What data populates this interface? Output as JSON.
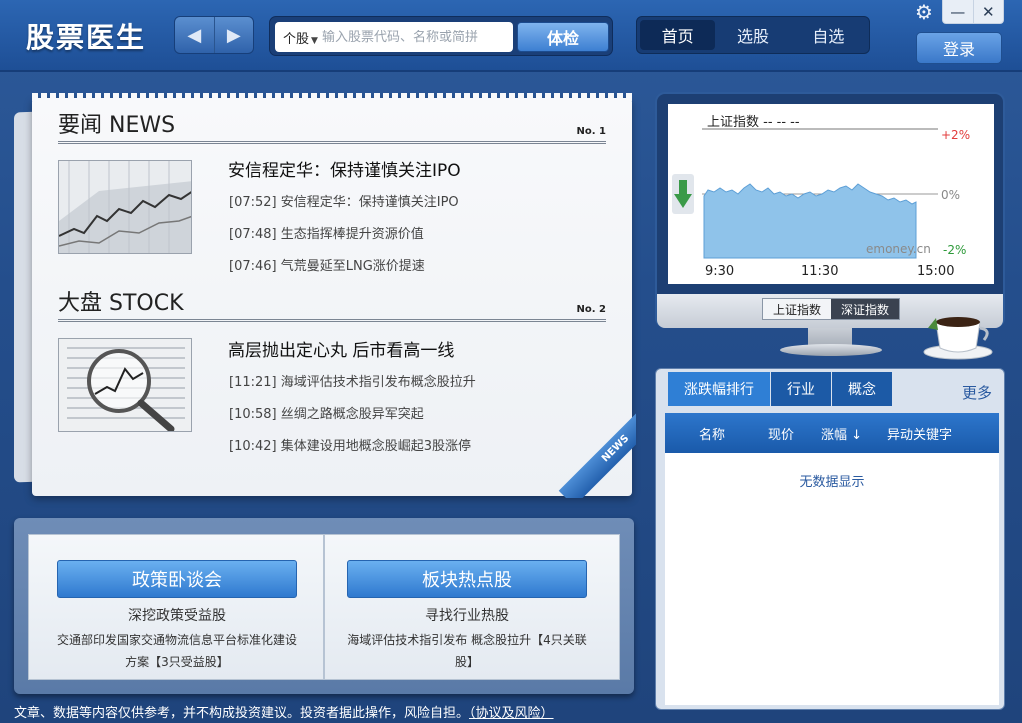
{
  "app": {
    "title": "股票医生"
  },
  "header": {
    "search_type": "个股",
    "search_placeholder": "输入股票代码、名称或简拼",
    "check_button": "体检",
    "tabs": [
      {
        "label": "首页",
        "active": true
      },
      {
        "label": "选股",
        "active": false
      },
      {
        "label": "自选",
        "active": false
      }
    ],
    "login_button": "登录",
    "window": {
      "minimize": "—",
      "close": "✕"
    }
  },
  "news": {
    "section1": {
      "title": "要闻 NEWS",
      "no": "No. 1",
      "headline": "安信程定华：保持谨慎关注IPO",
      "items": [
        "[07:52] 安信程定华：保持谨慎关注IPO",
        "[07:48] 生态指挥棒提升资源价值",
        "[07:46] 气荒曼延至LNG涨价提速"
      ]
    },
    "section2": {
      "title": "大盘 STOCK",
      "no": "No. 2",
      "headline": "高层抛出定心丸 后市看高一线",
      "items": [
        "[11:21] 海域评估技术指引发布概念股拉升",
        "[10:58] 丝绸之路概念股异军突起",
        "[10:42] 集体建设用地概念股崛起3股涨停"
      ]
    },
    "ribbon": "NEWS"
  },
  "book": {
    "left": {
      "button": "政策卧谈会",
      "subtitle": "深挖政策受益股",
      "desc": "交通部印发国家交通物流信息平台标准化建设方案【3只受益股】"
    },
    "right": {
      "button": "板块热点股",
      "subtitle": "寻找行业热股",
      "desc": "海域评估技术指引发布 概念股拉升【4只关联股】"
    }
  },
  "index_chart": {
    "title": "上证指数 -- -- --",
    "pct_labels": {
      "up": "+2%",
      "zero": "0%",
      "down": "-2%"
    },
    "watermark": "emoney.cn",
    "time_labels": [
      "9:30",
      "11:30",
      "15:00"
    ],
    "tabs": [
      {
        "label": "上证指数",
        "active": false
      },
      {
        "label": "深证指数",
        "active": true
      }
    ],
    "colors": {
      "up": "#e23b3b",
      "down": "#2e9a3a",
      "area": "#8fc3ea"
    }
  },
  "ranking": {
    "tabs": [
      {
        "label": "涨跌幅排行",
        "active": true
      },
      {
        "label": "行业",
        "active": false
      },
      {
        "label": "概念",
        "active": false
      }
    ],
    "more": "更多",
    "columns": {
      "name": "名称",
      "price": "现价",
      "change": "涨幅",
      "sort_arrow": "↓",
      "keyword": "异动关键字"
    },
    "empty_text": "无数据显示"
  },
  "footer": {
    "disclaimer": "文章、数据等内容仅供参考，并不构成投资建议。投资者据此操作，风险自担。",
    "link": "（协议及风险）"
  }
}
